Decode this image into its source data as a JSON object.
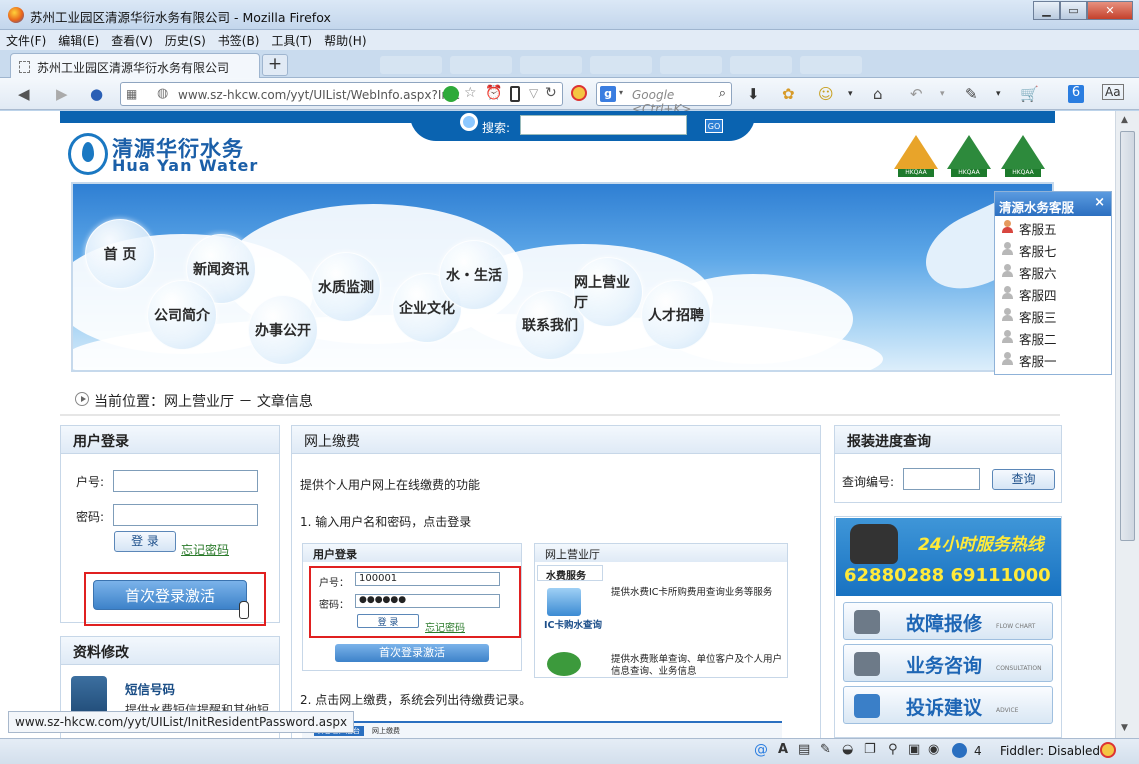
{
  "window": {
    "title": "苏州工业园区清源华衍水务有限公司 - Mozilla Firefox"
  },
  "menu": [
    "文件(F)",
    "编辑(E)",
    "查看(V)",
    "历史(S)",
    "书签(B)",
    "工具(T)",
    "帮助(H)"
  ],
  "tab": {
    "title": "苏州工业园区清源华衍水务有限公司",
    "new_tab": "+"
  },
  "nav": {
    "url": "www.sz-hkcw.com/yyt/UIList/WebInfo.aspx?Infc",
    "search_placeholder": "Google <Ctrl+K>",
    "search_engine": "g"
  },
  "header": {
    "search_label": "搜索:",
    "go": "GO",
    "logo_cn": "清源华衍水务",
    "logo_en": "Hua Yan Water",
    "cert_labels": [
      "HKQAA",
      "HKQAA",
      "HKQAA"
    ]
  },
  "banner_nav": [
    {
      "label": "首 页"
    },
    {
      "label": "新闻资讯"
    },
    {
      "label": "公司简介"
    },
    {
      "label": "办事公开"
    },
    {
      "label": "水质监测"
    },
    {
      "label": "企业文化"
    },
    {
      "label": "水・生活"
    },
    {
      "label": "联系我们"
    },
    {
      "label": "网上营业厅"
    },
    {
      "label": "人才招聘"
    }
  ],
  "breadcrumb": "当前位置：网上营业厅 － 文章信息",
  "login": {
    "title": "用户登录",
    "account_label": "户号:",
    "password_label": "密码:",
    "login_button": "登 录",
    "forgot": "忘记密码",
    "activate": "首次登录激活"
  },
  "profile": {
    "title": "资料修改",
    "item_title": "短信号码",
    "item_desc": "提供水费短信提醒和其他短"
  },
  "content": {
    "title": "网上缴费",
    "intro": "提供个人用户网上在线缴费的功能",
    "step1": "1. 输入用户名和密码，点击登录",
    "step2": "2. 点击网上缴费，系统会列出待缴费记录。",
    "mini": {
      "login_title": "用户登录",
      "account_label": "户号：",
      "account_value": "100001",
      "password_label": "密码：",
      "password_value": "●●●●●●",
      "login_button": "登 录",
      "forgot": "忘记密码",
      "activate": "首次登录激活",
      "hall_title": "网上营业厅",
      "fee_tab": "水费服务",
      "desc1": "提供水费IC卡所购费用查询业务等服务",
      "ic_label": "IC卡购水查询",
      "desc2": "提供水费账单查询、单位客户及个人用户信息查询、业务信息",
      "bottom_tabs": [
        "外部客户后台",
        "网上缴费"
      ]
    }
  },
  "progress": {
    "title": "报装进度查询",
    "label": "查询编号:",
    "button": "查询"
  },
  "hotline": {
    "title": "24小时服务热线",
    "numbers": "62880288   69111000",
    "buttons": [
      {
        "label": "故障报修",
        "sub": "FLOW CHART"
      },
      {
        "label": "业务咨询",
        "sub": "CONSULTATION"
      },
      {
        "label": "投诉建议",
        "sub": "ADVICE"
      }
    ]
  },
  "kefu": {
    "title": "清源水务客服",
    "close": "×",
    "items": [
      "客服五",
      "客服七",
      "客服六",
      "客服四",
      "客服三",
      "客服二",
      "客服一"
    ]
  },
  "status": {
    "link_hint": "www.sz-hkcw.com/yyt/UIList/InitResidentPassword.aspx",
    "count": "4",
    "fiddler": "Fiddler: Disabled"
  }
}
